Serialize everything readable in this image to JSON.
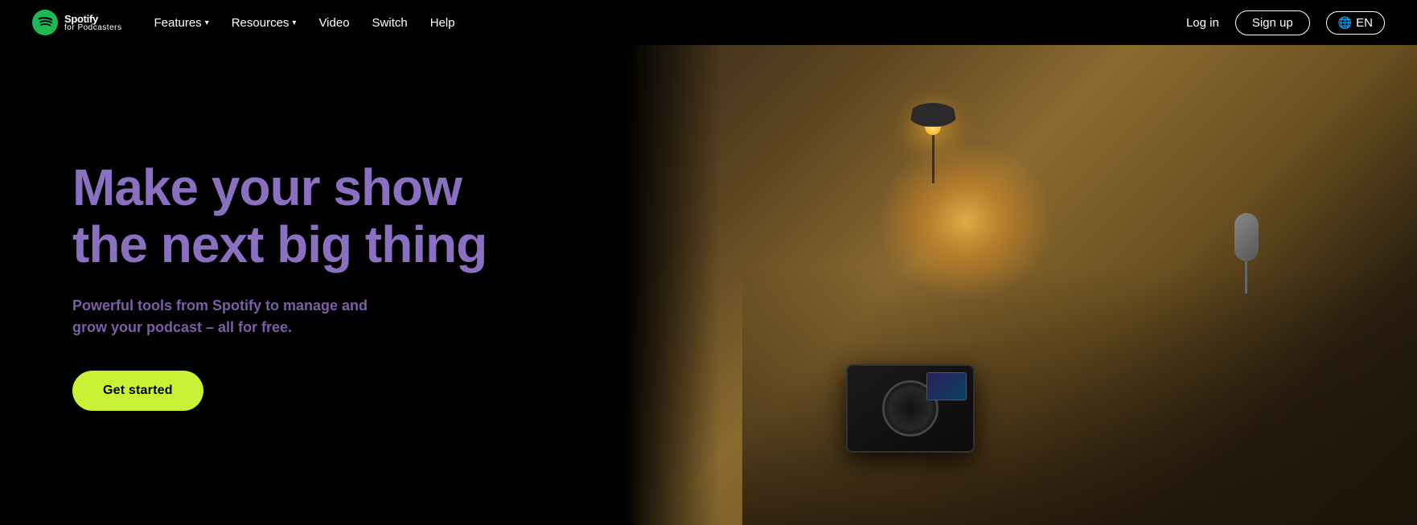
{
  "logo": {
    "brand": "Spotify",
    "sub": "for Podcasters",
    "icon": "🎵"
  },
  "nav": {
    "links": [
      {
        "id": "features",
        "label": "Features",
        "hasDropdown": true
      },
      {
        "id": "resources",
        "label": "Resources",
        "hasDropdown": true
      },
      {
        "id": "video",
        "label": "Video",
        "hasDropdown": false
      },
      {
        "id": "switch",
        "label": "Switch",
        "hasDropdown": false
      },
      {
        "id": "help",
        "label": "Help",
        "hasDropdown": false
      }
    ],
    "login_label": "Log in",
    "signup_label": "Sign up",
    "lang_label": "EN"
  },
  "hero": {
    "headline_line1": "Make your show",
    "headline_line2": "the next big thing",
    "subtext": "Powerful tools from Spotify to manage and grow your podcast – all for free.",
    "cta_label": "Get started"
  }
}
